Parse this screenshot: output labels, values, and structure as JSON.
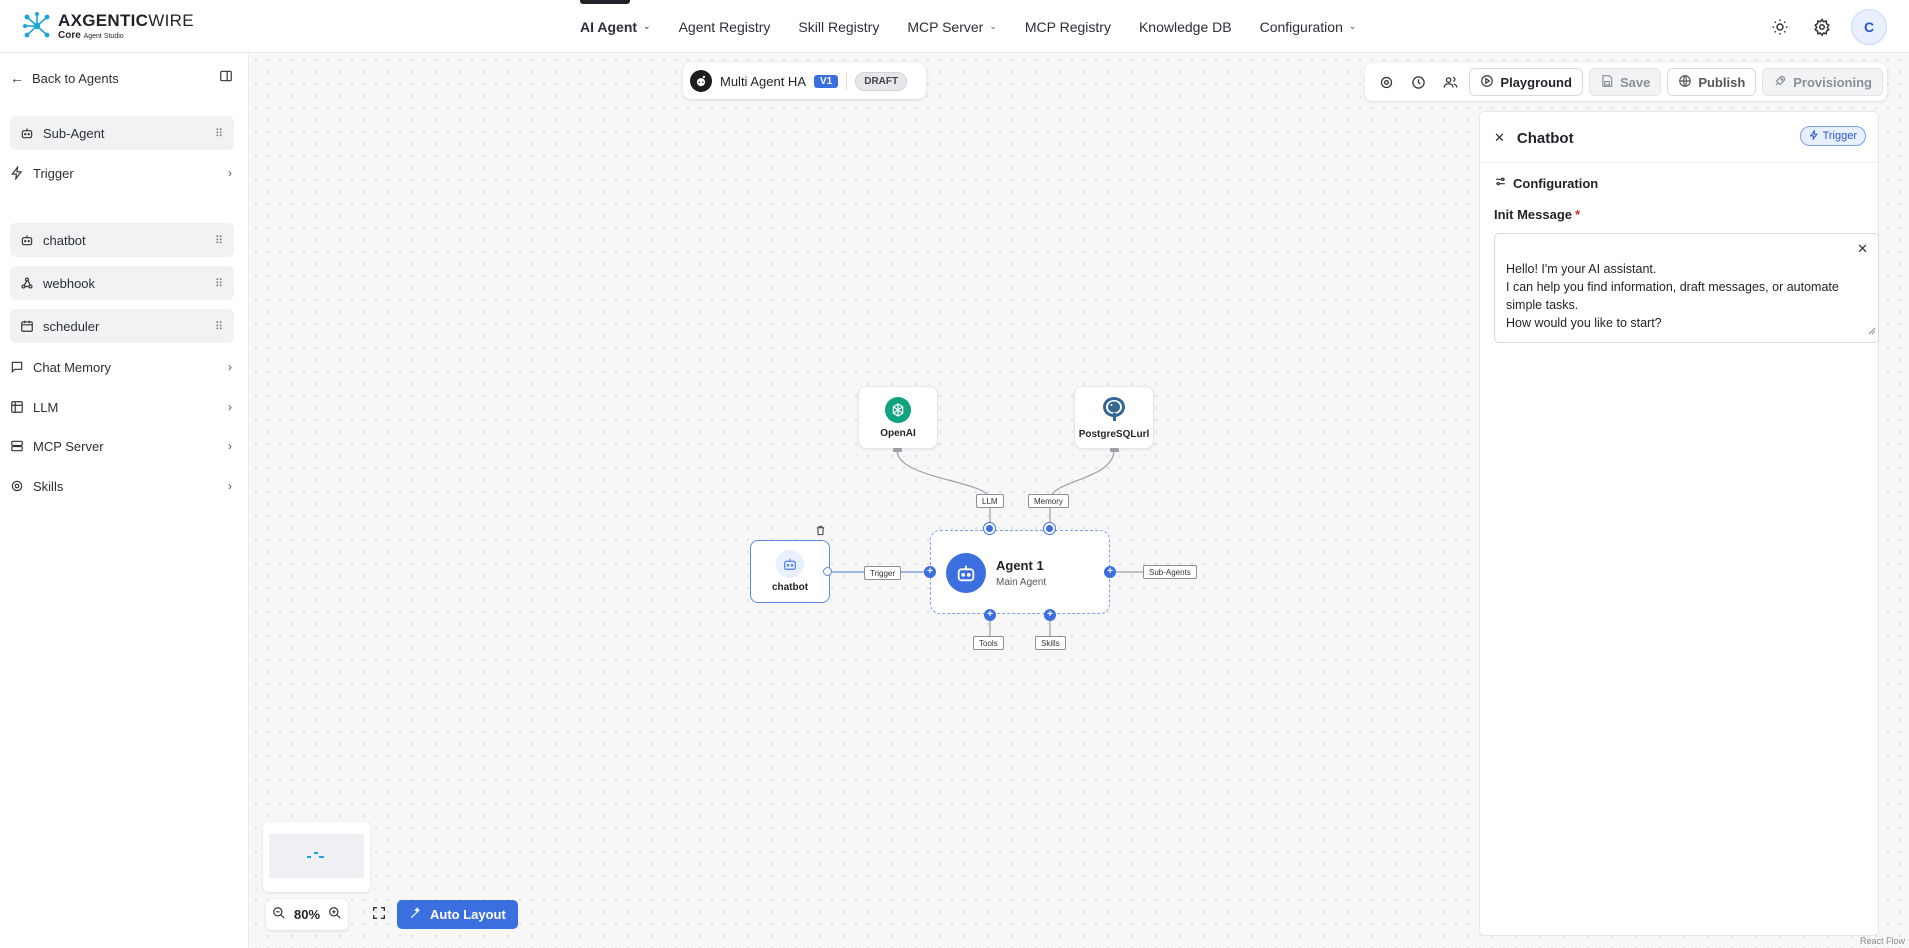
{
  "app": {
    "logo_main": "AXGENTIC",
    "logo_main_thin": "WIRE",
    "logo_sub": "Core",
    "logo_sub_small": "Agent Studio",
    "brand_color": "#1aa5d8"
  },
  "nav": {
    "items": [
      {
        "label": "AI Agent",
        "has_dropdown": true,
        "active": true
      },
      {
        "label": "Agent Registry",
        "has_dropdown": false
      },
      {
        "label": "Skill Registry",
        "has_dropdown": false
      },
      {
        "label": "MCP Server",
        "has_dropdown": true
      },
      {
        "label": "MCP Registry",
        "has_dropdown": false
      },
      {
        "label": "Knowledge DB",
        "has_dropdown": false
      },
      {
        "label": "Configuration",
        "has_dropdown": true
      }
    ],
    "avatar_initial": "C"
  },
  "sidebar": {
    "back_label": "Back to Agents",
    "items": [
      {
        "label": "Sub-Agent",
        "icon": "robot-icon",
        "style": "boxed"
      },
      {
        "label": "Trigger",
        "icon": "bolt-icon",
        "style": "plain"
      },
      {
        "label": "chatbot",
        "icon": "robot-icon",
        "style": "boxed"
      },
      {
        "label": "webhook",
        "icon": "webhook-icon",
        "style": "boxed"
      },
      {
        "label": "scheduler",
        "icon": "calendar-icon",
        "style": "boxed"
      },
      {
        "label": "Chat Memory",
        "icon": "chat-icon",
        "style": "plain"
      },
      {
        "label": "LLM",
        "icon": "llm-icon",
        "style": "plain"
      },
      {
        "label": "MCP Server",
        "icon": "server-icon",
        "style": "plain"
      },
      {
        "label": "Skills",
        "icon": "gear-icon",
        "style": "plain"
      }
    ]
  },
  "canvas": {
    "agent_name": "Multi Agent HA",
    "version": "V1",
    "status": "DRAFT",
    "toolbar": {
      "playground": "Playground",
      "save": "Save",
      "publish": "Publish",
      "provisioning": "Provisioning"
    },
    "nodes": {
      "openai": "OpenAI",
      "postgres": "PostgreSQLurl",
      "chatbot": "chatbot",
      "agent_title": "Agent 1",
      "agent_sub": "Main Agent"
    },
    "tags": {
      "llm": "LLM",
      "memory": "Memory",
      "trigger": "Trigger",
      "sub_agents": "Sub-Agents",
      "tools": "Tools",
      "skills": "Skills"
    },
    "zoom": "80%",
    "auto_layout": "Auto Layout",
    "attribution": "React Flow"
  },
  "panel": {
    "title": "Chatbot",
    "badge": "Trigger",
    "section": "Configuration",
    "field_label": "Init Message",
    "required_mark": "*",
    "init_message": "Hello! I'm your AI assistant.\nI can help you find information, draft messages, or automate simple tasks.\nHow would you like to start?"
  },
  "colors": {
    "accent": "#3b6fe0",
    "openai_green": "#10a37f",
    "postgres_blue": "#336791"
  }
}
